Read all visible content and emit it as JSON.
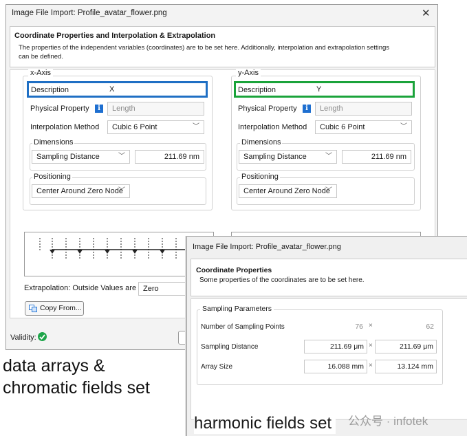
{
  "dialog1": {
    "title": "Image File Import: Profile_avatar_flower.png",
    "close_glyph": "✕",
    "header": {
      "title": "Coordinate Properties and Interpolation & Extrapolation",
      "text_line1": "The properties of the independent variables (coordinates) are to be set here. Additionally, interpolation and extrapolation settings",
      "text_line2": "can be defined."
    },
    "x_axis": {
      "label": "x-Axis",
      "description_label": "Description",
      "description_value": "X",
      "physical_property_label": "Physical Property",
      "physical_property_placeholder": "Length",
      "interpolation_label": "Interpolation Method",
      "interpolation_value": "Cubic 6 Point",
      "dimensions_label": "Dimensions",
      "dimensions_mode": "Sampling Distance",
      "dimensions_value": "211.69 nm",
      "positioning_label": "Positioning",
      "positioning_value": "Center Around Zero Node",
      "highlight_color": "#1f6fc4"
    },
    "y_axis": {
      "label": "y-Axis",
      "description_label": "Description",
      "description_value": "Y",
      "physical_property_label": "Physical Property",
      "physical_property_placeholder": "Length",
      "interpolation_label": "Interpolation Method",
      "interpolation_value": "Cubic 6 Point",
      "dimensions_label": "Dimensions",
      "dimensions_mode": "Sampling Distance",
      "dimensions_value": "211.69 nm",
      "positioning_label": "Positioning",
      "positioning_value": "Center Around Zero Node",
      "highlight_color": "#1aa33a"
    },
    "extrapolation_label": "Extrapolation: Outside Values are",
    "extrapolation_value": "Zero",
    "copy_from_label": "Copy From...",
    "validity_label": "Validity:"
  },
  "dialog2": {
    "title": "Image File Import: Profile_avatar_flower.png",
    "header": {
      "title": "Coordinate Properties",
      "text": "Some properties of the coordinates are to be set here."
    },
    "group_label": "Sampling Parameters",
    "rows": [
      {
        "label": "Number of Sampling Points",
        "x": "76",
        "y": "62",
        "readonly": true
      },
      {
        "label": "Sampling Distance",
        "x": "211.69 μm",
        "y": "211.69 μm",
        "readonly": false
      },
      {
        "label": "Array Size",
        "x": "16.088 mm",
        "y": "13.124 mm",
        "readonly": false
      }
    ],
    "times": "×"
  },
  "captions": {
    "left_line1": "data arrays &",
    "left_line2": "chromatic fields set",
    "right": "harmonic fields set"
  },
  "watermark": "公众号 · infotek"
}
